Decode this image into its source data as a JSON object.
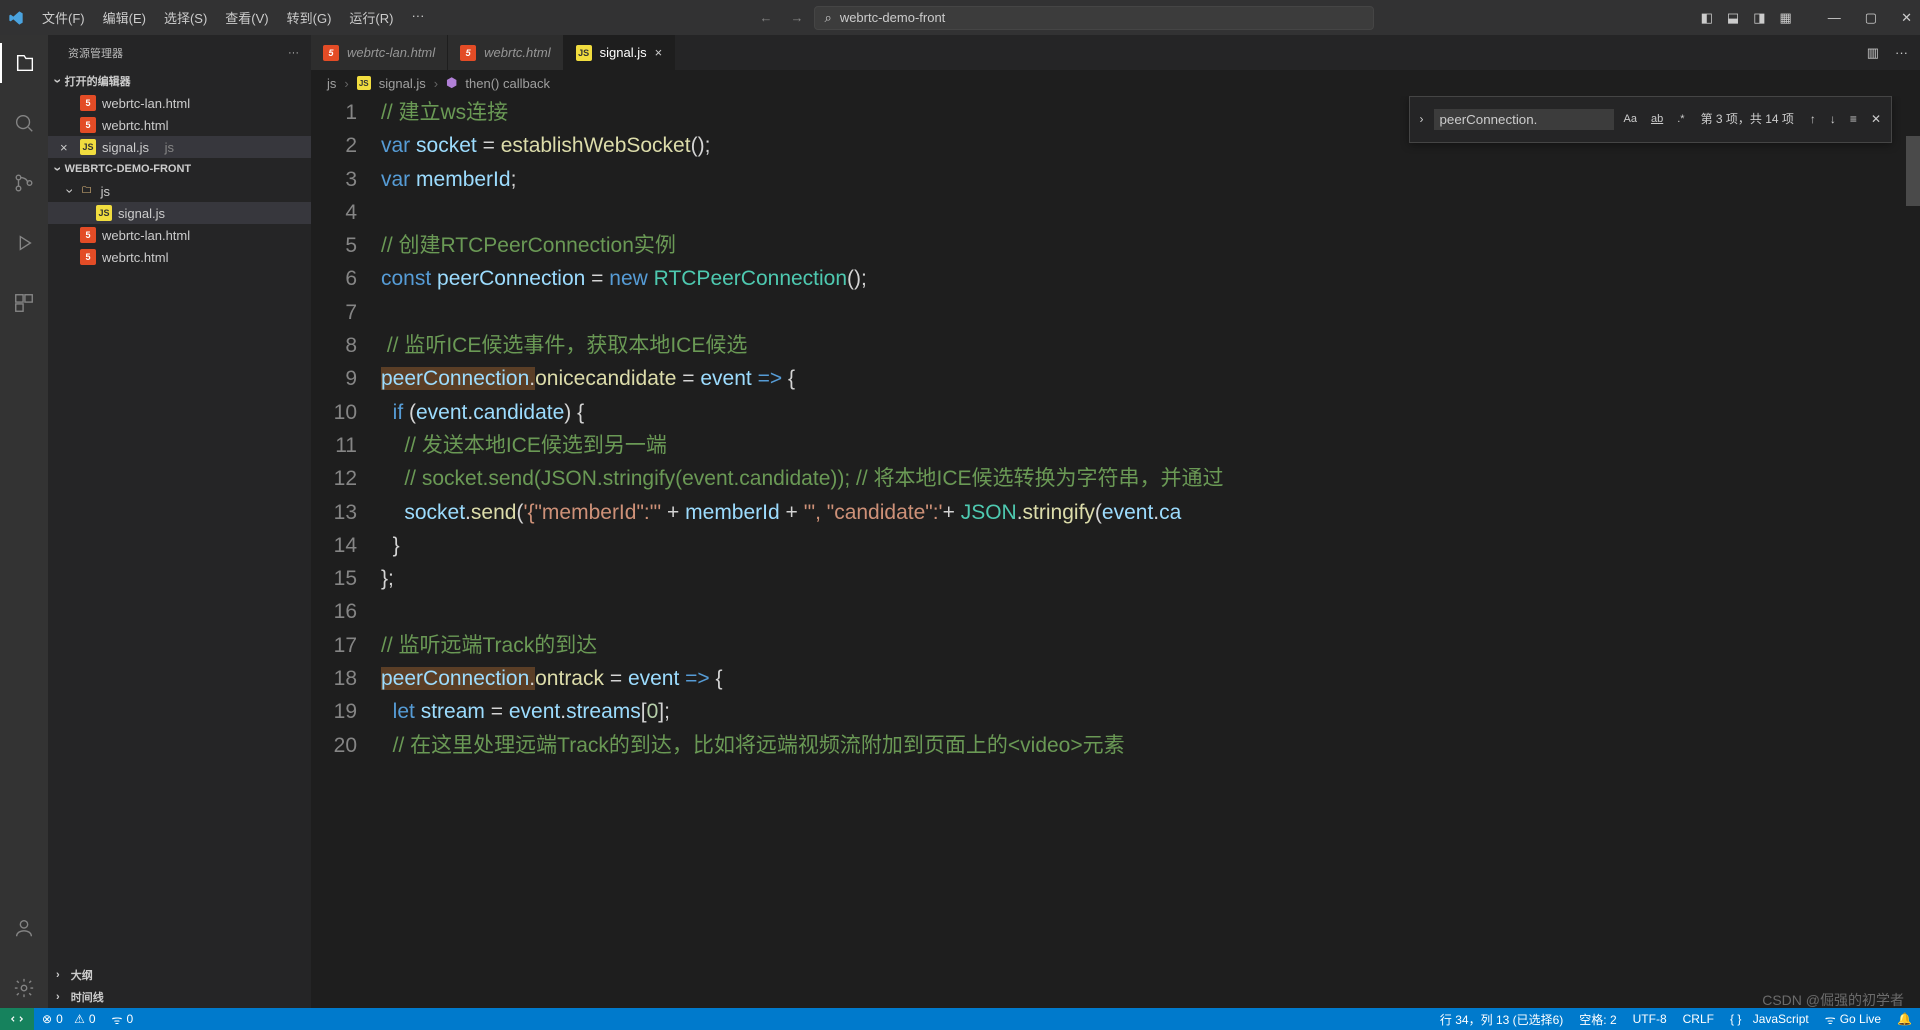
{
  "menu": {
    "file": "文件(F)",
    "edit": "编辑(E)",
    "select": "选择(S)",
    "view": "查看(V)",
    "goto": "转到(G)",
    "run": "运行(R)",
    "more": "···"
  },
  "title_search_text": "webrtc-demo-front",
  "sidebar": {
    "title": "资源管理器",
    "open_editors": "打开的编辑器",
    "open_files": [
      {
        "icon": "html",
        "name": "webrtc-lan.html"
      },
      {
        "icon": "html",
        "name": "webrtc.html"
      },
      {
        "icon": "js",
        "name": "signal.js",
        "suffix": "js",
        "active": true
      }
    ],
    "project": "WEBRTC-DEMO-FRONT",
    "folder": "js",
    "tree": [
      {
        "depth": 2,
        "icon": "js",
        "name": "signal.js",
        "active": true
      },
      {
        "depth": 1,
        "icon": "html",
        "name": "webrtc-lan.html"
      },
      {
        "depth": 1,
        "icon": "html",
        "name": "webrtc.html"
      }
    ],
    "outline": "大纲",
    "timeline": "时间线"
  },
  "tabs": [
    {
      "icon": "html",
      "name": "webrtc-lan.html"
    },
    {
      "icon": "html",
      "name": "webrtc.html",
      "italic": true
    },
    {
      "icon": "js",
      "name": "signal.js",
      "active": true
    }
  ],
  "breadcrumbs": {
    "a": "js",
    "b": "signal.js",
    "c": "then() callback"
  },
  "find": {
    "value": "peerConnection.",
    "result": "第 3 项，共 14 项"
  },
  "code_lines": [
    "1",
    "2",
    "3",
    "4",
    "5",
    "6",
    "7",
    "8",
    "9",
    "10",
    "11",
    "12",
    "13",
    "14",
    "15",
    "16",
    "17",
    "18",
    "19",
    "20"
  ],
  "status": {
    "errors": "0",
    "warnings": "0",
    "ports": "0",
    "cursor": "行 34，列 13 (已选择6)",
    "spaces": "空格: 2",
    "encoding": "UTF-8",
    "eol": "CRLF",
    "lang": "JavaScript",
    "golive": "Go Live"
  },
  "watermark": "CSDN @倔强的初学者"
}
